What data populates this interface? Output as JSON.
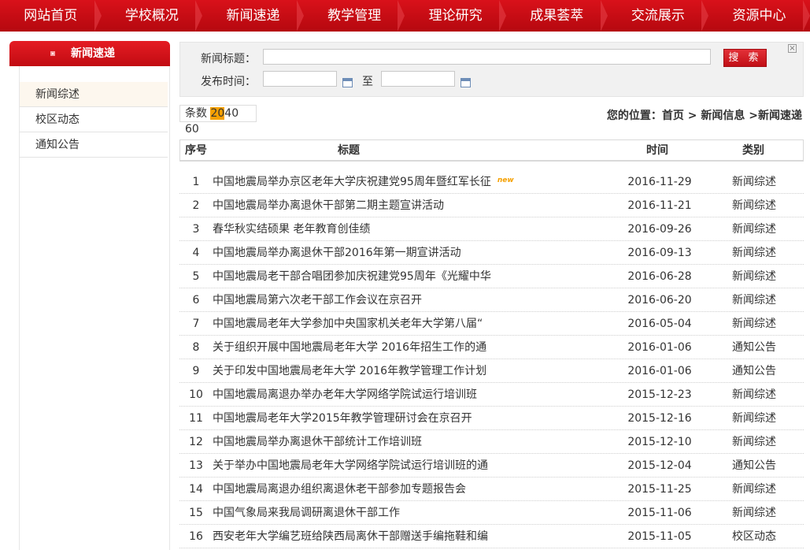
{
  "nav": [
    "网站首页",
    "学校概况",
    "新闻速递",
    "教学管理",
    "理论研究",
    "成果荟萃",
    "交流展示",
    "资源中心"
  ],
  "sidebar": {
    "title": "新闻速递",
    "items": [
      "新闻综述",
      "校区动态",
      "通知公告"
    ]
  },
  "search": {
    "title_label": "新闻标题：",
    "date_label": "发布时间：",
    "to_label": "至",
    "button": "搜 索",
    "close": "×"
  },
  "page_size": {
    "label": "条数",
    "options": [
      "20",
      "40",
      "60"
    ],
    "selected": "20"
  },
  "breadcrumb": "您的位置：首页 > 新闻信息 >新闻速递",
  "table": {
    "headers": {
      "no": "序号",
      "title": "标题",
      "date": "时间",
      "category": "类别"
    },
    "new_badge": "new",
    "rows": [
      {
        "no": "1",
        "title": "中国地震局举办京区老年大学庆祝建党95周年暨红军长征",
        "date": "2016-11-29",
        "category": "新闻综述",
        "is_new": true
      },
      {
        "no": "2",
        "title": "中国地震局举办离退休干部第二期主题宣讲活动",
        "date": "2016-11-21",
        "category": "新闻综述"
      },
      {
        "no": "3",
        "title": "春华秋实结硕果 老年教育创佳绩",
        "date": "2016-09-26",
        "category": "新闻综述"
      },
      {
        "no": "4",
        "title": "中国地震局举办离退休干部2016年第一期宣讲活动",
        "date": "2016-09-13",
        "category": "新闻综述"
      },
      {
        "no": "5",
        "title": "中国地震局老干部合唱团参加庆祝建党95周年《光耀中华",
        "date": "2016-06-28",
        "category": "新闻综述"
      },
      {
        "no": "6",
        "title": "中国地震局第六次老干部工作会议在京召开",
        "date": "2016-06-20",
        "category": "新闻综述"
      },
      {
        "no": "7",
        "title": "中国地震局老年大学参加中央国家机关老年大学第八届“",
        "date": "2016-05-04",
        "category": "新闻综述"
      },
      {
        "no": "8",
        "title": "关于组织开展中国地震局老年大学 2016年招生工作的通",
        "date": "2016-01-06",
        "category": "通知公告"
      },
      {
        "no": "9",
        "title": "关于印发中国地震局老年大学 2016年教学管理工作计划",
        "date": "2016-01-06",
        "category": "通知公告"
      },
      {
        "no": "10",
        "title": "中国地震局离退办举办老年大学网络学院试运行培训班",
        "date": "2015-12-23",
        "category": "新闻综述"
      },
      {
        "no": "11",
        "title": "中国地震局老年大学2015年教学管理研讨会在京召开",
        "date": "2015-12-16",
        "category": "新闻综述"
      },
      {
        "no": "12",
        "title": "中国地震局举办离退休干部统计工作培训班",
        "date": "2015-12-10",
        "category": "新闻综述"
      },
      {
        "no": "13",
        "title": "关于举办中国地震局老年大学网络学院试运行培训班的通",
        "date": "2015-12-04",
        "category": "通知公告"
      },
      {
        "no": "14",
        "title": "中国地震局离退办组织离退休老干部参加专题报告会",
        "date": "2015-11-25",
        "category": "新闻综述"
      },
      {
        "no": "15",
        "title": "中国气象局来我局调研离退休干部工作",
        "date": "2015-11-06",
        "category": "新闻综述"
      },
      {
        "no": "16",
        "title": "西安老年大学编艺班给陕西局离休干部赠送手编拖鞋和编",
        "date": "2015-11-05",
        "category": "校区动态"
      }
    ]
  }
}
